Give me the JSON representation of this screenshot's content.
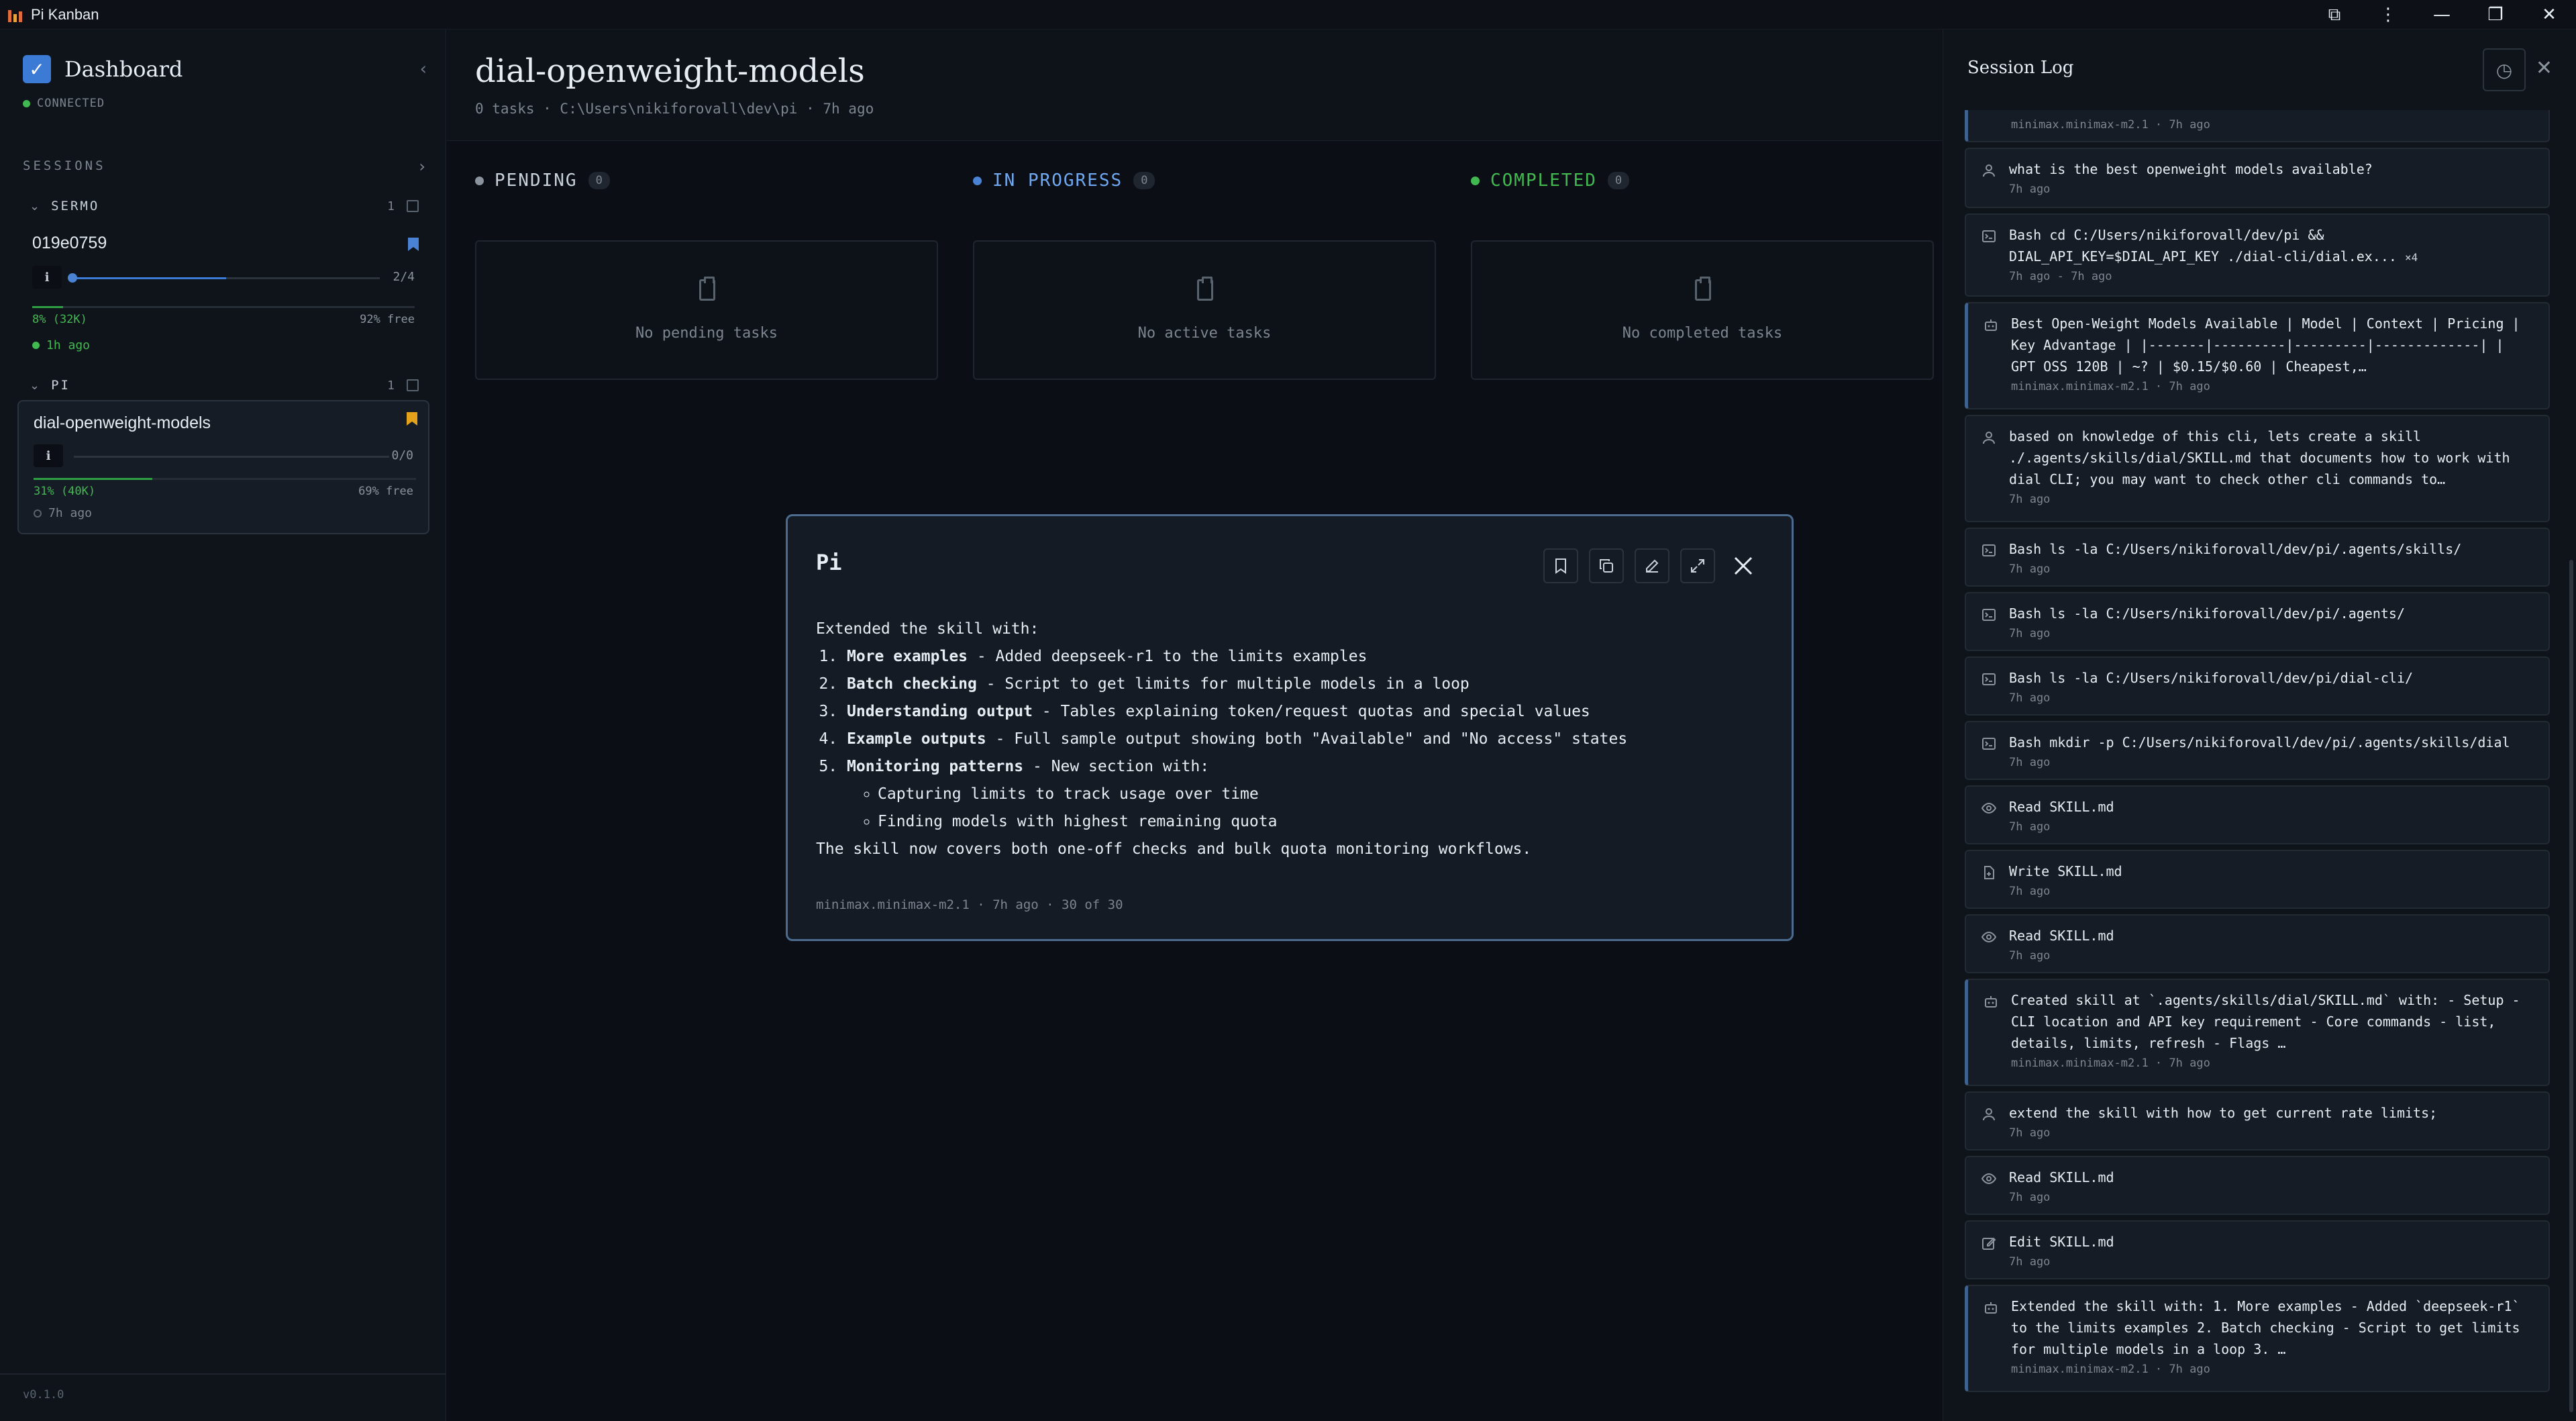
{
  "window": {
    "title": "Pi Kanban",
    "controls": {
      "extension": "⧉",
      "menu": "⋮",
      "minimize": "—",
      "restore": "❐",
      "close": "✕"
    }
  },
  "sidebar": {
    "title": "Dashboard",
    "status": "CONNECTED",
    "sessions_label": "SESSIONS",
    "groups": [
      {
        "name": "SERMO",
        "count": "1",
        "session": {
          "name": "019e0759",
          "progress": "2/4",
          "context": "8% (32K)",
          "free": "92% free",
          "time": "1h ago",
          "progress_fraction": 0.5,
          "context_fraction": 0.08,
          "status_color": "#3fb950",
          "bookmark_color": "#4a83d4"
        }
      },
      {
        "name": "PI",
        "count": "1",
        "session": {
          "name": "dial-openweight-models",
          "progress": "0/0",
          "context": "31% (40K)",
          "free": "69% free",
          "time": "7h ago",
          "progress_fraction": 0,
          "context_fraction": 0.31,
          "status_color": "#59636e",
          "bookmark_color": "#e3a21a"
        }
      }
    ],
    "version": "v0.1.0"
  },
  "main": {
    "title": "dial-openweight-models",
    "subtitle": "0 tasks · C:\\Users\\nikiforovall\\dev\\pi · 7h ago",
    "columns": [
      {
        "label": "PENDING",
        "count": "0",
        "empty": "No pending tasks",
        "color": "#8b949e",
        "text_color": "#c9d1d9"
      },
      {
        "label": "IN PROGRESS",
        "count": "0",
        "empty": "No active tasks",
        "color": "#4a83d4",
        "text_color": "#6ea8f0"
      },
      {
        "label": "COMPLETED",
        "count": "0",
        "empty": "No completed tasks",
        "color": "#3fb950",
        "text_color": "#3fb950"
      }
    ]
  },
  "modal": {
    "title": "Pi",
    "intro": "Extended the skill with:",
    "items": [
      {
        "bold": "More examples",
        "text": " - Added deepseek-r1 to the limits examples"
      },
      {
        "bold": "Batch checking",
        "text": " - Script to get limits for multiple models in a loop"
      },
      {
        "bold": "Understanding output",
        "text": " - Tables explaining token/request quotas and special values"
      },
      {
        "bold": "Example outputs",
        "text": " - Full sample output showing both \"Available\" and \"No access\" states"
      },
      {
        "bold": "Monitoring patterns",
        "text": " - New section with:"
      }
    ],
    "subitems": [
      "Capturing limits to track usage over time",
      "Finding models with highest remaining quota"
    ],
    "outro": "The skill now covers both one-off checks and bulk quota monitoring workflows.",
    "meta": "minimax.minimax-m2.1 · 7h ago · 30 of 30"
  },
  "log": {
    "title": "Session Log",
    "top_meta": "minimax.minimax-m2.1 · 7h ago",
    "items": [
      {
        "kind": "user",
        "icon": "user-icon",
        "text": "what is the best openweight models available?",
        "meta": "7h ago"
      },
      {
        "kind": "tool",
        "icon": "terminal-icon",
        "text": "Bash cd C:/Users/nikiforovall/dev/pi && DIAL_API_KEY=$DIAL_API_KEY ./dial-cli/dial.ex...",
        "badge": "×4",
        "meta": "7h ago - 7h ago"
      },
      {
        "kind": "ai",
        "icon": "bot-icon",
        "text": "Best Open-Weight Models Available | Model | Context | Pricing | Key Advantage | |-------|---------|---------|-------------| | GPT OSS 120B | ~? | $0.15/$0.60 | Cheapest,…",
        "meta": "minimax.minimax-m2.1 · 7h ago"
      },
      {
        "kind": "user",
        "icon": "user-icon",
        "text": "based on knowledge of this cli, lets create a skill ./.agents/skills/dial/SKILL.md that documents how to work with dial CLI; you may want to check other cli commands to…",
        "meta": "7h ago"
      },
      {
        "kind": "tool",
        "icon": "terminal-icon",
        "text": "Bash ls -la C:/Users/nikiforovall/dev/pi/.agents/skills/",
        "meta": "7h ago"
      },
      {
        "kind": "tool",
        "icon": "terminal-icon",
        "text": "Bash ls -la C:/Users/nikiforovall/dev/pi/.agents/",
        "meta": "7h ago"
      },
      {
        "kind": "tool",
        "icon": "terminal-icon",
        "text": "Bash ls -la C:/Users/nikiforovall/dev/pi/dial-cli/",
        "meta": "7h ago"
      },
      {
        "kind": "tool",
        "icon": "terminal-icon",
        "text": "Bash mkdir -p C:/Users/nikiforovall/dev/pi/.agents/skills/dial",
        "meta": "7h ago"
      },
      {
        "kind": "tool",
        "icon": "eye-icon",
        "text": "Read SKILL.md",
        "meta": "7h ago"
      },
      {
        "kind": "tool",
        "icon": "file-plus-icon",
        "text": "Write SKILL.md",
        "meta": "7h ago"
      },
      {
        "kind": "tool",
        "icon": "eye-icon",
        "text": "Read SKILL.md",
        "meta": "7h ago"
      },
      {
        "kind": "ai",
        "icon": "bot-icon",
        "text": "Created skill at `.agents/skills/dial/SKILL.md` with: - Setup - CLI location and API key requirement - Core commands - list, details, limits, refresh - Flags …",
        "meta": "minimax.minimax-m2.1 · 7h ago"
      },
      {
        "kind": "user",
        "icon": "user-icon",
        "text": "extend the skill with how to get current rate limits;",
        "meta": "7h ago"
      },
      {
        "kind": "tool",
        "icon": "eye-icon",
        "text": "Read SKILL.md",
        "meta": "7h ago"
      },
      {
        "kind": "tool",
        "icon": "edit-icon",
        "text": "Edit SKILL.md",
        "meta": "7h ago"
      },
      {
        "kind": "ai",
        "icon": "bot-icon",
        "text": "Extended the skill with: 1. More examples - Added `deepseek-r1` to the limits examples 2. Batch checking - Script to get limits for multiple models in a loop 3. …",
        "meta": "minimax.minimax-m2.1 · 7h ago"
      }
    ]
  }
}
